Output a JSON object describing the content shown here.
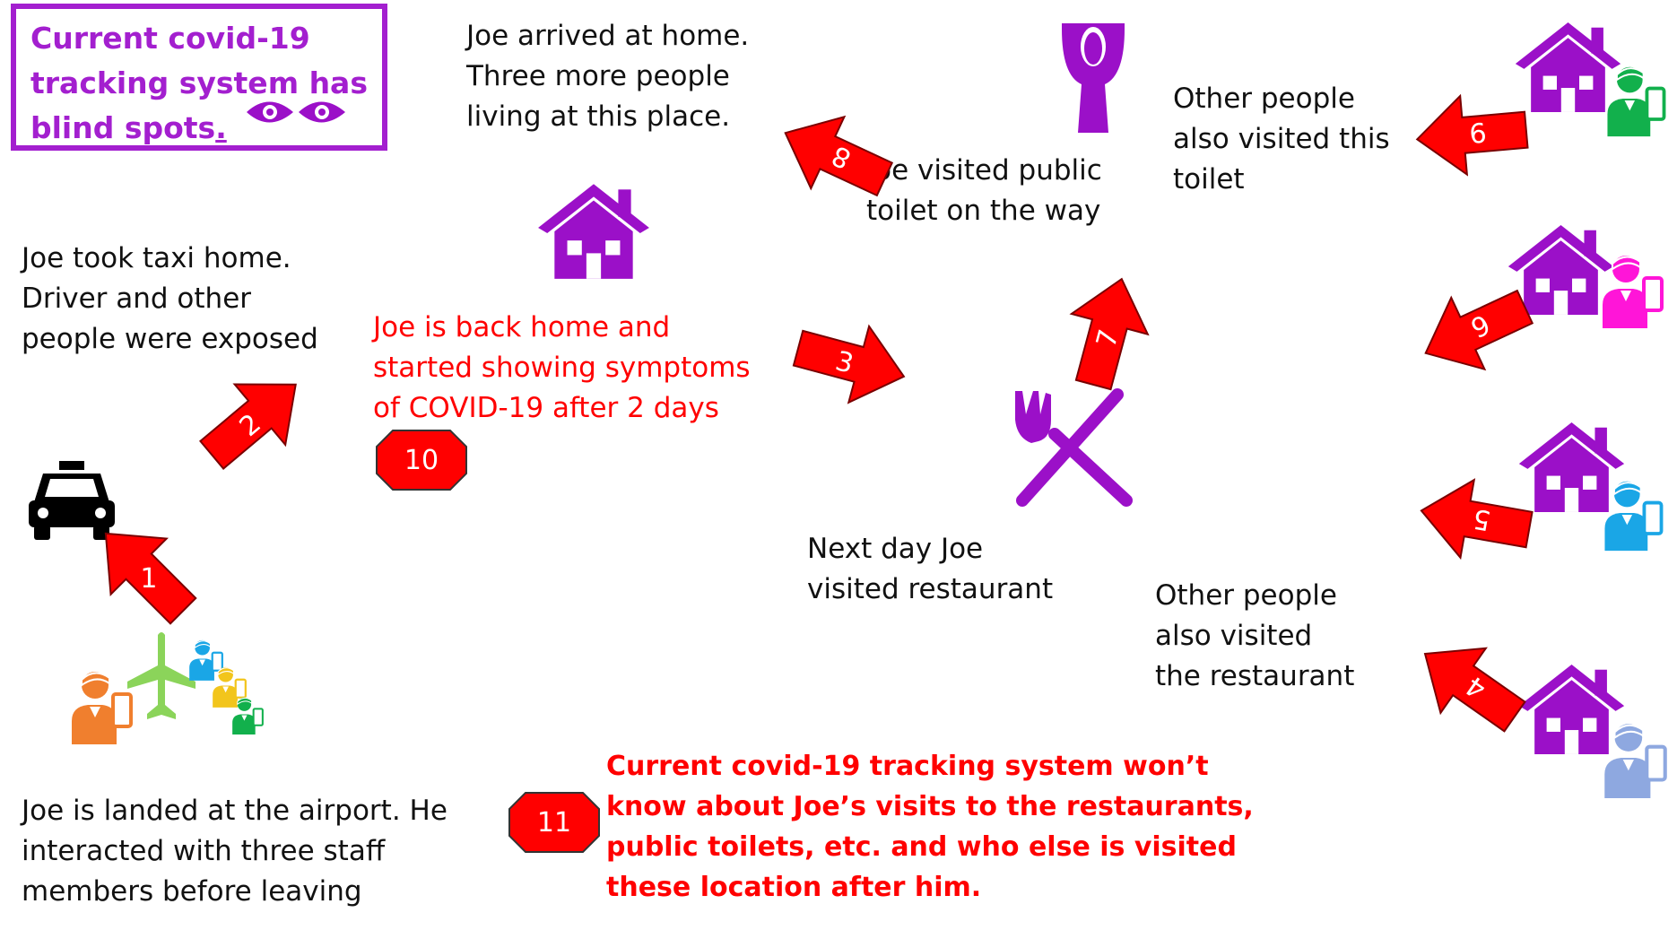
{
  "colors": {
    "accent_purple": "#9b10c8",
    "arrow_red": "#ff0000",
    "text_red": "#ff0000",
    "person_orange": "#f07f2e",
    "person_blue": "#1aa6e6",
    "person_yellow": "#f2c51c",
    "person_green": "#12b04c",
    "person_pink": "#ff15d8",
    "person_lightblue": "#8ea8e0",
    "plane_green": "#8bd45a"
  },
  "title": {
    "line1": "Current covid-19",
    "line2": "tracking system has",
    "line3": "blind spots",
    "dot": ".",
    "icon": "eyes-icon"
  },
  "captions": {
    "airport_1": "Joe is landed at the airport. He",
    "airport_2": "interacted with three staff",
    "airport_3": "members before leaving",
    "taxi_1": "Joe took taxi home.",
    "taxi_2": "Driver and other",
    "taxi_3": "people were exposed",
    "home_1": "Joe arrived at home.",
    "home_2": "Three more people",
    "home_3": "living at this place.",
    "back_1": "Joe is back home and",
    "back_2": "started showing symptoms",
    "back_3": "of COVID-19 after 2 days",
    "toilet_1": "Joe visited public",
    "toilet_2": "toilet on the way",
    "restaurant_1": "Next day Joe",
    "restaurant_2": "visited restaurant",
    "other_toilet_1": "Other people",
    "other_toilet_2": "also visited this",
    "other_toilet_3": "toilet",
    "other_rest_1": "Other people",
    "other_rest_2": "also visited",
    "other_rest_3": "the restaurant",
    "blind_1": "Current covid-19 tracking system won’t",
    "blind_2": "know about Joe’s visits to the restaurants,",
    "blind_3": "public toilets, etc. and who else is visited",
    "blind_4": "these location after him."
  },
  "arrows": {
    "a1": "1",
    "a2": "2",
    "a3": "3",
    "a4": "4",
    "a5": "5",
    "a6": "6",
    "a7": "7",
    "a8": "8",
    "a9": "9"
  },
  "badges": {
    "b10": "10",
    "b11": "11"
  },
  "icons": {
    "taxi": "taxi-icon",
    "plane": "airplane-icon",
    "house": "house-icon",
    "toilet": "toilet-icon",
    "cutlery": "fork-knife-icon",
    "person": "person-with-phone-icon"
  }
}
